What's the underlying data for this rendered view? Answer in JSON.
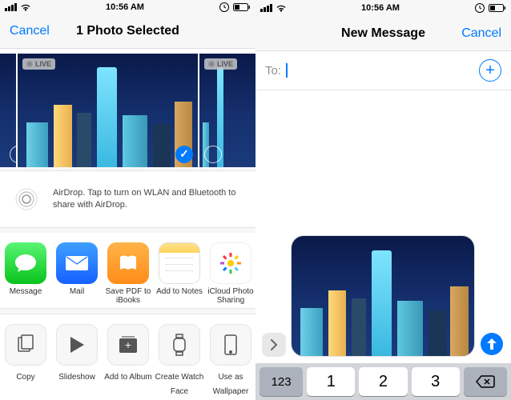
{
  "status": {
    "time": "10:56 AM"
  },
  "left": {
    "nav": {
      "cancel": "Cancel",
      "title": "1 Photo Selected"
    },
    "live_badge": "LIVE",
    "airdrop": {
      "text": "AirDrop. Tap to turn on WLAN and Bluetooth to share with AirDrop."
    },
    "share": [
      {
        "label": "Message"
      },
      {
        "label": "Mail"
      },
      {
        "label": "Save PDF to iBooks"
      },
      {
        "label": "Add to Notes"
      },
      {
        "label": "iCloud Photo Sharing"
      }
    ],
    "actions": [
      {
        "label": "Copy"
      },
      {
        "label": "Slideshow"
      },
      {
        "label": "Add to Album"
      },
      {
        "label": "Create Watch Face"
      },
      {
        "label": "Use as Wallpaper"
      }
    ]
  },
  "right": {
    "nav": {
      "title": "New Message",
      "cancel": "Cancel"
    },
    "to_label": "To:",
    "to_value": "",
    "keys": {
      "mode": "123",
      "k1": "1",
      "k2": "2",
      "k3": "3"
    }
  },
  "colors": {
    "accent": "#007aff"
  }
}
